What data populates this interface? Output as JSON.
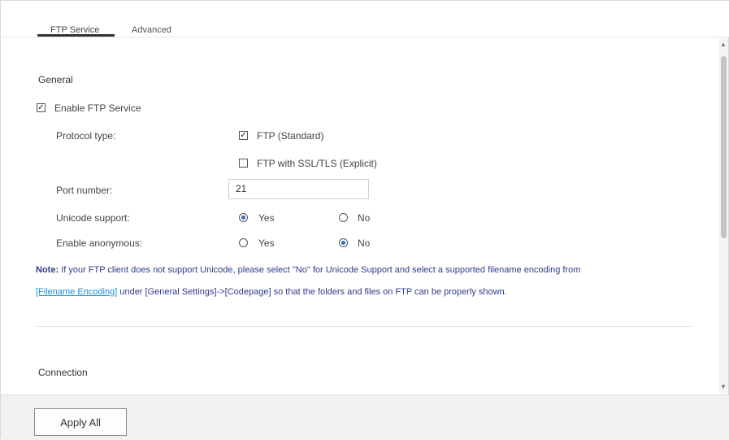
{
  "tabs": [
    {
      "label": "FTP Service",
      "active": true
    },
    {
      "label": "Advanced",
      "active": false
    }
  ],
  "general": {
    "title": "General",
    "enable_ftp": {
      "label": "Enable FTP Service",
      "checked": true
    },
    "protocol": {
      "label": "Protocol type:",
      "options": [
        {
          "label": "FTP (Standard)",
          "checked": true
        },
        {
          "label": "FTP with SSL/TLS (Explicit)",
          "checked": false
        }
      ]
    },
    "port": {
      "label": "Port number:",
      "value": "21"
    },
    "unicode": {
      "label": "Unicode support:",
      "options": [
        {
          "label": "Yes",
          "selected": true
        },
        {
          "label": "No",
          "selected": false
        }
      ]
    },
    "anonymous": {
      "label": "Enable anonymous:",
      "options": [
        {
          "label": "Yes",
          "selected": false
        },
        {
          "label": "No",
          "selected": true
        }
      ]
    },
    "note": {
      "prefix": "Note:",
      "line1_rest": " If your FTP client does not support Unicode, please select \"No\" for Unicode Support and select a supported filename encoding from",
      "link": "[Filename Encoding]",
      "line2_rest": " under [General Settings]->[Codepage] so that the folders and files on FTP can be properly shown."
    }
  },
  "connection": {
    "title": "Connection"
  },
  "footer": {
    "apply_label": "Apply All"
  },
  "colors": {
    "accent": "#2f6bd1",
    "note_text": "#2d3d8a",
    "link": "#1a8fd6"
  }
}
